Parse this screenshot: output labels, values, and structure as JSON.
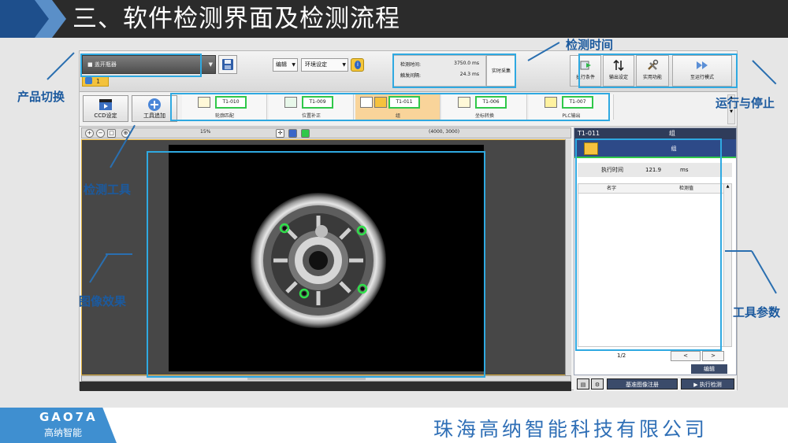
{
  "slide": {
    "title": "三、软件检测界面及检测流程",
    "footer_logo": "GAO7A",
    "footer_logo_sub": "高纳智能",
    "footer_company": "珠海高纳智能科技有限公司"
  },
  "annotations": {
    "product_switch": "产品切换",
    "detect_time": "检测时间",
    "run_stop": "运行与停止",
    "detect_tool": "检测工具",
    "image_effect": "图像效果",
    "tool_params": "工具参数"
  },
  "toolbar": {
    "product_name": "■ 盖开瓶器",
    "product_number": "1",
    "edit_dropdown": "编辑",
    "env_dropdown": "环境设定",
    "detect_time_label": "检测时间:",
    "detect_time_value": "3750.0 ms",
    "trigger_interval_label": "触发间隔:",
    "trigger_interval_value": "24.3 ms",
    "realtime_button": "实时采集",
    "exec_condition": "执行条件",
    "output_setting": "输出设定",
    "util_function": "实用功能",
    "run_mode": "至运行模式"
  },
  "tool_strip": {
    "ccd_setting": "CCD设定",
    "add_tool": "工具追加",
    "tools": [
      {
        "id": "T1-010",
        "name": "轮廓匹配"
      },
      {
        "id": "T1-009",
        "name": "位置补正"
      },
      {
        "id": "T1-011",
        "name": "组"
      },
      {
        "id": "T1-006",
        "name": "坐标转换"
      },
      {
        "id": "T1-007",
        "name": "PLC输出"
      }
    ]
  },
  "viewer": {
    "zoom_level": "15%",
    "resolution": "(4000, 3000)"
  },
  "right_panel": {
    "tool_id": "T1-011",
    "tool_name": "组",
    "tab_label": "组",
    "exec_time_label": "执行时间",
    "exec_time_value": "121.9",
    "exec_time_unit": "ms",
    "col_name": "名字",
    "col_value": "检测值",
    "page": "1/2",
    "prev": "<",
    "next": ">",
    "edit": "编辑"
  },
  "bottom_actions": {
    "register_ref": "基准图像注册",
    "exec_detect": "执行检测"
  },
  "colors": {
    "annotation_blue": "#2fa9e1",
    "active_tool": "#f9d49a",
    "tool_id_green": "#2fc84a",
    "panel_navy": "#2f3c5a"
  }
}
